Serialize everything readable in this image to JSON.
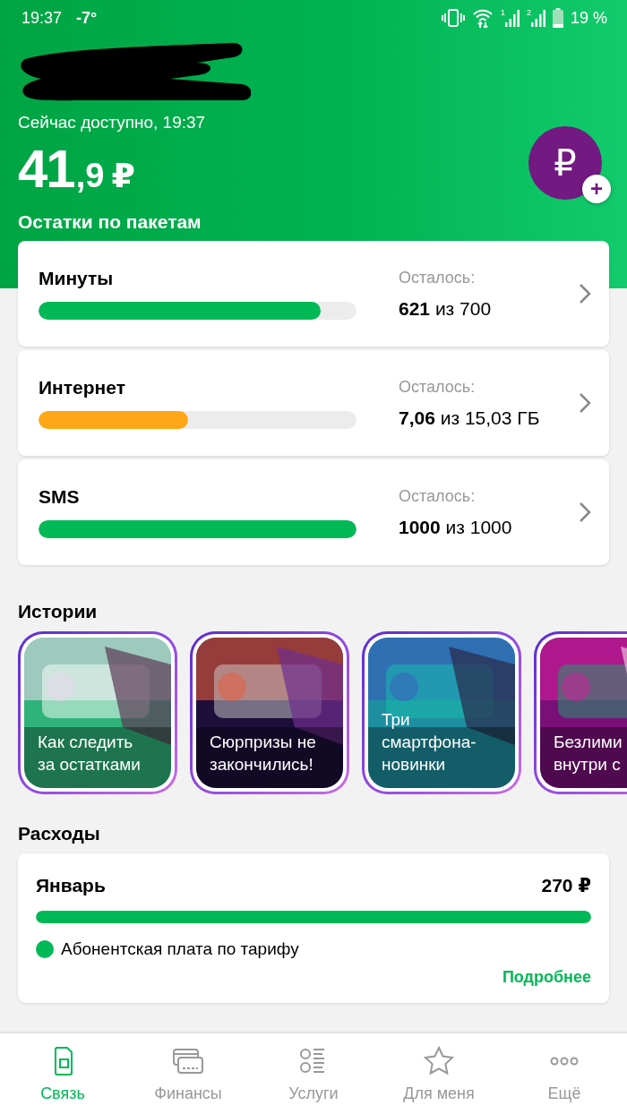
{
  "status_bar": {
    "time": "19:37",
    "temperature": "-7°",
    "sim_labels": [
      "1",
      "2"
    ],
    "battery": "19 %"
  },
  "header": {
    "available": "Сейчас доступно, 19:37",
    "balance": {
      "integer": "41",
      "fraction": ",9",
      "currency": "₽"
    },
    "topup_button": {
      "symbol": "₽",
      "badge": "+"
    }
  },
  "packages": {
    "title": "Остатки по пакетам",
    "items": [
      {
        "name": "Минуты",
        "remaining_label": "Осталось:",
        "remaining": "**621** из 700",
        "level": 0.887,
        "color": "#00b956"
      },
      {
        "name": "Интернет",
        "remaining_label": "Осталось:",
        "remaining": "**7,06** из 15,03 ГБ",
        "level": 0.47,
        "color": "#ffa717"
      },
      {
        "name": "SMS",
        "remaining_label": "Осталось:",
        "remaining": "**1000** из 1000",
        "level": 1,
        "color": "#00b956"
      }
    ]
  },
  "stories": {
    "title": "Истории",
    "items": [
      {
        "title": "Как следить\nза остатками",
        "kind": "picture"
      },
      {
        "title": "Сюрпризы не\nзакончились!",
        "kind": "picture"
      },
      {
        "title": "Три\nсмартфона-\nновинки",
        "kind": "picture"
      },
      {
        "title": "Безлими\nвнутри с",
        "kind": "picture"
      }
    ]
  },
  "expenses": {
    "title": "Расходы",
    "month": "Январь",
    "total": "270 ₽",
    "level": 1,
    "legend": [
      {
        "label": "Абонентская плата по тарифу",
        "color": "#00b956"
      }
    ],
    "details_link": "Подробнее"
  },
  "bottom_nav": [
    {
      "label": "Связь",
      "kind": "sim",
      "selected": true
    },
    {
      "label": "Финансы",
      "kind": "cards",
      "selected": false
    },
    {
      "label": "Услуги",
      "kind": "list",
      "selected": false
    },
    {
      "label": "Для меня",
      "kind": "star",
      "selected": false
    },
    {
      "label": "Ещё",
      "kind": "dots",
      "selected": false
    }
  ]
}
